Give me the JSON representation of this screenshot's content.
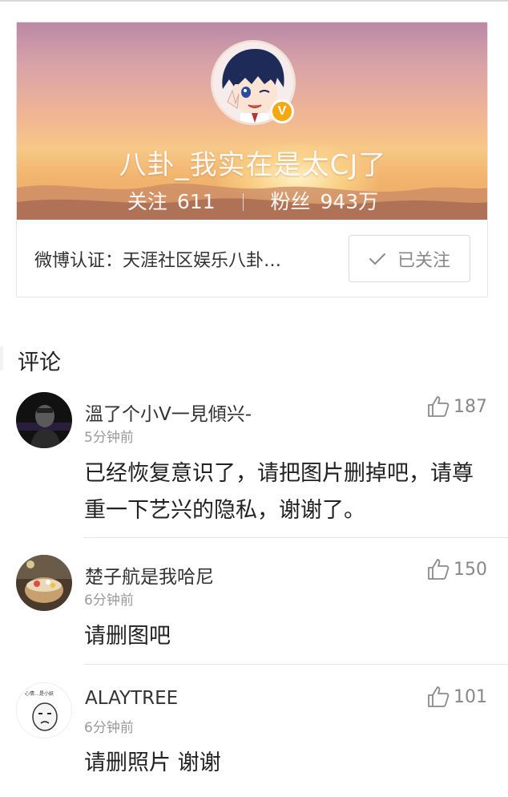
{
  "profile": {
    "username": "八卦_我实在是太CJ了",
    "following_label": "关注",
    "following_count": "611",
    "followers_label": "粉丝",
    "followers_count": "943万",
    "verification": "微博认证：天涯社区娱乐八卦…",
    "follow_button_label": "已关注",
    "verified_badge": "V",
    "colors": {
      "badge": "#f6a80f"
    },
    "icons": [
      "verified-badge-icon",
      "check-icon"
    ]
  },
  "comments_section": {
    "title": "评论",
    "comments": [
      {
        "author": "溫了个小V一見傾兴-",
        "time": "5分钟前",
        "text": "已经恢复意识了，请把图片删掉吧，请尊重一下艺兴的隐私，谢谢了。",
        "likes": "187"
      },
      {
        "author": "楚子航是我哈尼",
        "time": "6分钟前",
        "text": "请删图吧",
        "likes": "150"
      },
      {
        "author": "ALAYTREE",
        "time": "6分钟前",
        "text": "请删照片 谢谢",
        "likes": "101"
      }
    ],
    "avatar3_caption": "心情…是小妖",
    "icons": [
      "thumbs-up-icon"
    ]
  }
}
